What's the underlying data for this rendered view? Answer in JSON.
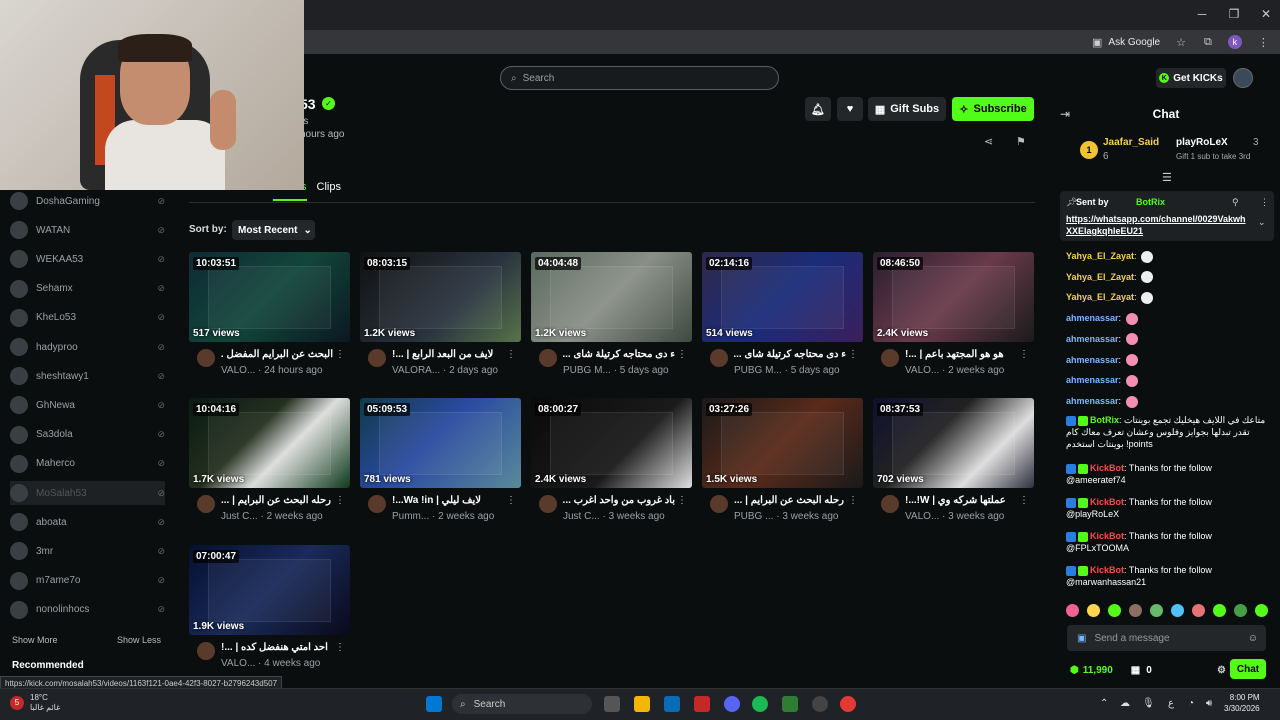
{
  "browser": {
    "ask_google": "Ask Google",
    "profile_letter": "k",
    "status_url": "https://kick.com/mosalah53/videos/1163f121-0ae4-42f3-8027-b2796243d507"
  },
  "header": {
    "search_placeholder": "Search",
    "get_kicks": "Get KICKs"
  },
  "channel": {
    "name_fragment": "53",
    "followers_fragment": "rs",
    "last_live_fragment": "hours ago",
    "gift_subs": "Gift Subs",
    "subscribe": "Subscribe",
    "tabs": [
      "Home",
      "About",
      "Videos",
      "Clips"
    ],
    "sort_label": "Sort by:",
    "sort_value": "Most Recent"
  },
  "sidebar": {
    "items": [
      {
        "label": "DoshaGaming"
      },
      {
        "label": "WATAN"
      },
      {
        "label": "WEKAA53"
      },
      {
        "label": "Sehamx"
      },
      {
        "label": "KheLo53"
      },
      {
        "label": "hadyproo"
      },
      {
        "label": "sheshtawy1"
      },
      {
        "label": "GhNewa"
      },
      {
        "label": "Sa3dola"
      },
      {
        "label": "Maherco"
      },
      {
        "label": "MoSalah53"
      },
      {
        "label": "aboata"
      },
      {
        "label": "3mr"
      },
      {
        "label": "m7ame7o"
      },
      {
        "label": "nonolinhocs"
      }
    ],
    "show_more": "Show More",
    "show_less": "Show Less",
    "recommended": "Recommended"
  },
  "videos": [
    {
      "duration": "10:03:51",
      "views": "517 views",
      "title": "البحث عن البرايم المفضل ...",
      "channel": "VALO...",
      "age": "24 hours ago"
    },
    {
      "duration": "08:03:15",
      "views": "1.2K views",
      "title": "لايف من البعد الرابع | ...!",
      "channel": "VALORA...",
      "age": "2 days ago"
    },
    {
      "duration": "04:04:48",
      "views": "1.2K views",
      "title": "ء دى محتاجه كرتيلة شاى ...",
      "channel": "PUBG M...",
      "age": "5 days ago"
    },
    {
      "duration": "02:14:16",
      "views": "514 views",
      "title": "ء دى محتاجه كرتيلة شاى ...",
      "channel": "PUBG M...",
      "age": "5 days ago"
    },
    {
      "duration": "08:46:50",
      "views": "2.4K views",
      "title": "هو هو المجتهد باعم | ...!",
      "channel": "VALO...",
      "age": "2 weeks ago"
    },
    {
      "duration": "10:04:16",
      "views": "1.7K views",
      "title": "رحله البحث عن البرايم | ...",
      "channel": "Just C...",
      "age": "2 weeks ago"
    },
    {
      "duration": "05:09:53",
      "views": "781 views",
      "title": "لايف ليلي | Wa !in...!",
      "channel": "Pumm...",
      "age": "2 weeks ago"
    },
    {
      "duration": "08:00:27",
      "views": "2.4K views",
      "title": "باد غروب من واحد اغرب ...",
      "channel": "Just C...",
      "age": "3 weeks ago"
    },
    {
      "duration": "03:27:26",
      "views": "1.5K views",
      "title": "رحله البحث عن البرايم | ...",
      "channel": "PUBG ...",
      "age": "3 weeks ago"
    },
    {
      "duration": "08:37:53",
      "views": "702 views",
      "title": "عملتها شركه وي | W!...!",
      "channel": "VALO...",
      "age": "3 weeks ago"
    },
    {
      "duration": "07:00:47",
      "views": "1.9K views",
      "title": "احد امتي هنفضل كده | ...!",
      "channel": "VALO...",
      "age": "4 weeks ago"
    }
  ],
  "chat": {
    "title": "Chat",
    "top_gifter_1": "Jaafar_Said",
    "top_gifter_1_count": "6",
    "top_gifter_1_rank": "1",
    "top_gifter_2": "playRoLeX",
    "top_gifter_2_count": "3",
    "gift_hint": "Gift 1 sub to take 3rd",
    "pinned_sent_by": "Sent by",
    "pinned_user": "BotRix",
    "pinned_link": "https://whatsapp.com/channel/0029VakwhXXElagkqhleEU21",
    "messages": [
      {
        "user": "Yahya_El_Zayat",
        "text": ""
      },
      {
        "user": "Yahya_El_Zayat",
        "text": ""
      },
      {
        "user": "Yahya_El_Zayat",
        "text": ""
      },
      {
        "user": "ahmenassar",
        "text": ""
      },
      {
        "user": "ahmenassar",
        "text": ""
      },
      {
        "user": "ahmenassar",
        "text": ""
      },
      {
        "user": "ahmenassar",
        "text": ""
      },
      {
        "user": "ahmenassar",
        "text": ""
      }
    ],
    "botrix_msg": "متاعك في اللايف هيخليك تجمع بوينتات تقدر تبدلها بجوايز وفلوس وعشان تعرف معاك كام بوينتات استخدم !points",
    "botrix_user": "BotRix",
    "kickbot_user": "KickBot",
    "follows": [
      {
        "text": "Thanks for the follow @ameeratef74"
      },
      {
        "text": "Thanks for the follow @playRoLeX"
      },
      {
        "text": "Thanks for the follow @FPLxTOOMA"
      },
      {
        "text": "Thanks for the follow @marwanhassan21"
      }
    ],
    "input_placeholder": "Send a message",
    "kicks_balance": "11,990",
    "points": "0",
    "chat_button": "Chat"
  },
  "taskbar": {
    "temp": "18°C",
    "weather_text": "غائم غالبا",
    "search": "Search",
    "time": "8:00 PM",
    "date": "3/30/2026",
    "lang": "ع",
    "notif_count": "5"
  },
  "colors": {
    "kick_green": "#53fc18",
    "background": "#0b0e0f"
  }
}
